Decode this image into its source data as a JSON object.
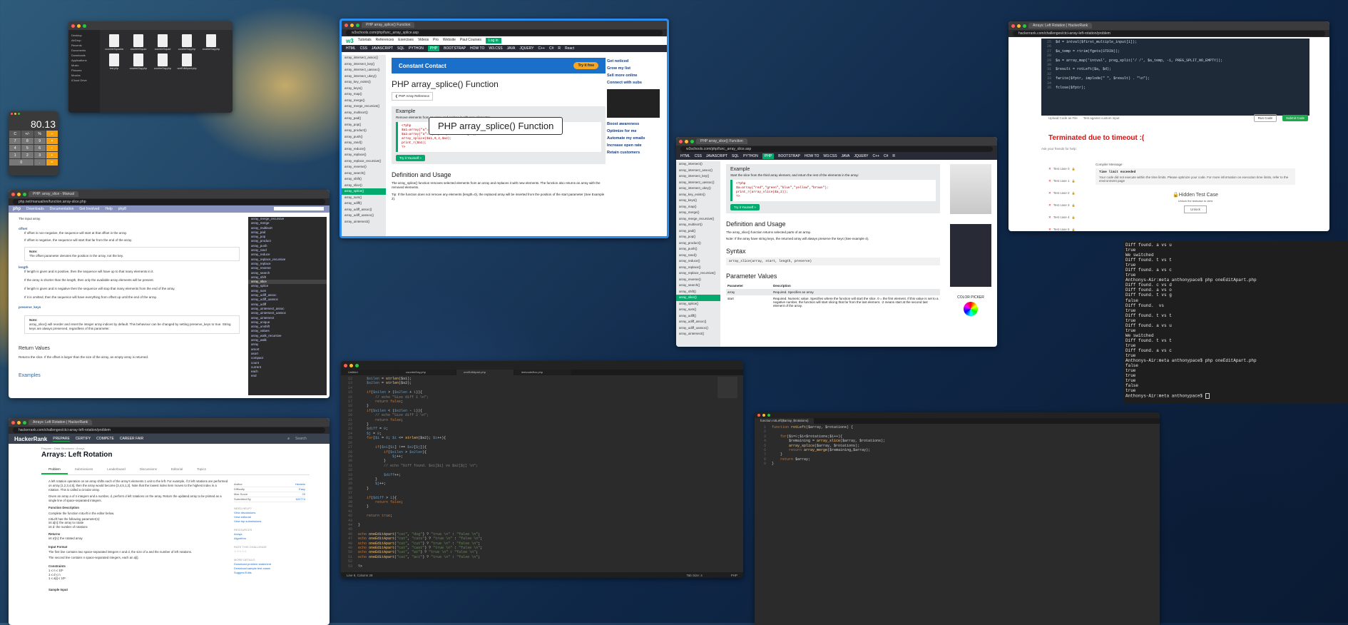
{
  "finder": {
    "sidebar": [
      "Desktop",
      "AirDrop",
      "Recents",
      "Documents",
      "Downloads",
      "Applications",
      "Music",
      "Pictures",
      "Movies",
      "iCloud Drive"
    ],
    "files": [
      "countrieSquadra",
      "countrieSquad",
      "countrieSquad",
      "counterDay.php",
      "counterDay.php",
      "test.php",
      "counterDay.php",
      "counterDay.php",
      "oneEditApart.php"
    ]
  },
  "calculator": {
    "display": "80.13",
    "keys": [
      "C",
      "+/-",
      "%",
      "÷",
      "7",
      "8",
      "9",
      "×",
      "4",
      "5",
      "6",
      "−",
      "1",
      "2",
      "3",
      "+",
      "0",
      ".",
      "="
    ]
  },
  "w3main": {
    "tabs": [
      "PHP array_splice() Function"
    ],
    "url": "w3schools.com/php/func_array_splice.asp",
    "nav": [
      "HTML",
      "CSS",
      "JAVASCRIPT",
      "SQL",
      "PYTHON",
      "PHP",
      "BOOTSTRAP",
      "HOW TO",
      "W3.CSS",
      "JAVA",
      "JQUERY",
      "C++",
      "C#",
      "R",
      "React"
    ],
    "top_links": [
      "Tutorials",
      "References",
      "Exercises",
      "Videos",
      "Pro",
      "Website",
      "Paul Courses",
      "Log in"
    ],
    "ad_text": "Constant Contact",
    "ad_button": "Try it free",
    "heading": "PHP array_splice() Function",
    "ref_button": "❮ PHP Array Reference",
    "example_label": "Example",
    "example_desc": "Remove elements from an array and replace it with new elements:",
    "code_lines": [
      "<?php",
      "$a1=array(\"a\"=>\"red\",\"b\"=>\"green\",\"c\"=>\"blue\",\"d\"=>\"yellow\");",
      "$a2=array(\"a\"=>\"purple\",\"b\"=>\"orange\");",
      "array_splice($a1,0,2,$a2);",
      "print_r($a1);",
      "?>"
    ],
    "try_button": "Try it Yourself »",
    "def_heading": "Definition and Usage",
    "def_text": "The array_splice() function removes selected elements from an array and replaces it with new elements. The function also returns an array with the removed elements.",
    "tip": "Tip: If the function does not remove any elements (length=0), the replaced array will be inserted from the position of the start parameter (See Example 2).",
    "sidebar": [
      "array_intersect_assoc()",
      "array_intersect_key()",
      "array_intersect_uassoc()",
      "array_intersect_ukey()",
      "array_key_exists()",
      "array_keys()",
      "array_map()",
      "array_merge()",
      "array_merge_recursive()",
      "array_multisort()",
      "array_pad()",
      "array_pop()",
      "array_product()",
      "array_push()",
      "array_rand()",
      "array_reduce()",
      "array_replace()",
      "array_replace_recursive()",
      "array_reverse()",
      "array_search()",
      "array_shift()",
      "array_slice()",
      "array_splice()",
      "array_sum()",
      "array_udiff()",
      "array_udiff_assoc()",
      "array_udiff_uassoc()",
      "array_uintersect()"
    ],
    "active_item": "array_splice()",
    "right_ads": [
      "Get noticed",
      "Grow my list",
      "Sell more online",
      "Connect with subs",
      "Boost awareness",
      "Optimize for me",
      "Automate my emails",
      "Increase open rate",
      "Retain customers"
    ],
    "tooltip": "PHP array_splice() Function"
  },
  "w3slice": {
    "tabs": [
      "PHP array_slice() Function"
    ],
    "url": "w3schools.com/php/func_array_slice.asp",
    "nav": [
      "HTML",
      "CSS",
      "JAVASCRIPT",
      "SQL",
      "PYTHON",
      "PHP",
      "BOOTSTRAP",
      "HOW TO",
      "W3.CSS",
      "JAVA",
      "JQUERY",
      "C++",
      "C#",
      "R"
    ],
    "example_label": "Example",
    "example_desc": "Start the slice from the third array element, and return the rest of the elements in the array:",
    "code_lines": [
      "<?php",
      "$a=array(\"red\",\"green\",\"blue\",\"yellow\",\"brown\");",
      "print_r(array_slice($a,2));",
      "?>"
    ],
    "try_button": "Try it Yourself »",
    "def_heading": "Definition and Usage",
    "def_text": "The array_slice() function returns selected parts of an array.",
    "note": "Note: If the array have string keys, the returned array will always preserve the keys (See example 4).",
    "syntax_heading": "Syntax",
    "syntax": "array_slice(array, start, length, preserve)",
    "param_heading": "Parameter Values",
    "param_cols": [
      "Parameter",
      "Description"
    ],
    "params": [
      {
        "name": "array",
        "desc": "Required. Specifies an array"
      },
      {
        "name": "start",
        "desc": "Required. Numeric value. Specifies where the function will start the slice. 0 = the first element. If this value is set to a negative number, the function will start slicing that far from the last element. -2 means start at the second last element of the array."
      }
    ],
    "sidebar": [
      "array_intersect()",
      "array_intersect_assoc()",
      "array_intersect_key()",
      "array_intersect_uassoc()",
      "array_intersect_ukey()",
      "array_key_exists()",
      "array_keys()",
      "array_map()",
      "array_merge()",
      "array_merge_recursive()",
      "array_multisort()",
      "array_pad()",
      "array_pop()",
      "array_product()",
      "array_push()",
      "array_rand()",
      "array_reduce()",
      "array_replace()",
      "array_replace_recursive()",
      "array_reverse()",
      "array_search()",
      "array_shift()",
      "array_slice()",
      "array_splice()",
      "array_sum()",
      "array_udiff()",
      "array_udiff_assoc()",
      "array_udiff_uassoc()",
      "array_uintersect()"
    ],
    "active_item": "array_slice()",
    "color_picker": "COLOR PICKER"
  },
  "phpnet": {
    "tabs": [
      "PHP: array_slice - Manual"
    ],
    "url": "php.net/manual/en/function.array-slice.php",
    "nav": [
      "php",
      "Downloads",
      "Documentation",
      "Get Involved",
      "Help",
      "php8"
    ],
    "search_placeholder": "Search",
    "input_label": "The input array.",
    "offset_heading": "offset",
    "offset_1": "If offset is non-negative, the sequence will start at that offset in the array.",
    "offset_2": "If offset is negative, the sequence will start that far from the end of the array.",
    "note_label": "Note:",
    "note_text": "The offset parameter denotes the position in the array, not the key.",
    "length_heading": "length",
    "length_1": "If length is given and is positive, then the sequence will have up to that many elements in it.",
    "length_2": "If the array is shorter than the length, then only the available array elements will be present.",
    "length_3": "If length is given and is negative then the sequence will stop that many elements from the end of the array.",
    "length_4": "If it is omitted, then the sequence will have everything from offset up until the end of the array.",
    "preserve_heading": "preserve_keys",
    "preserve_text": "array_slice() will reorder and reset the integer array indices by default. This behaviour can be changed by setting preserve_keys to true. String keys are always preserved, regardless of this parameter.",
    "return_heading": "Return Values",
    "return_text": "Returns the slice. If the offset is larger than the size of the array, an empty array is returned.",
    "examples_heading": "Examples",
    "sidebar": [
      "array_merge_recursive",
      "array_merge",
      "array_multisort",
      "array_pad",
      "array_pop",
      "array_product",
      "array_push",
      "array_rand",
      "array_reduce",
      "array_replace_recursive",
      "array_replace",
      "array_reverse",
      "array_search",
      "array_shift",
      "array_slice",
      "array_splice",
      "array_sum",
      "array_udiff_assoc",
      "array_udiff_uassoc",
      "array_udiff",
      "array_uintersect_assoc",
      "array_uintersect_uassoc",
      "array_uintersect",
      "array_unique",
      "array_unshift",
      "array_values",
      "array_walk_recursive",
      "array_walk",
      "array",
      "arsort",
      "asort",
      "compact",
      "count",
      "current",
      "each",
      "end"
    ]
  },
  "hr_top": {
    "tabs": [
      "Arrays: Left Rotation | HackerRank"
    ],
    "url": "hackerrank.com/challenges/ctci-array-left-rotation/problem",
    "code_lines": [
      {
        "n": "25",
        "t": "$d = intval($first_multiple_input[1]);"
      },
      {
        "n": "26",
        "t": ""
      },
      {
        "n": "27",
        "t": "$a_temp = rtrim(fgets(STDIN));"
      },
      {
        "n": "28",
        "t": ""
      },
      {
        "n": "29",
        "t": "$a = array_map('intval', preg_split('/ /', $a_temp, -1, PREG_SPLIT_NO_EMPTY));"
      },
      {
        "n": "30",
        "t": ""
      },
      {
        "n": "31",
        "t": "$result = rotLeft($a, $d);"
      },
      {
        "n": "32",
        "t": ""
      },
      {
        "n": "33",
        "t": "fwrite($fptr, implode(\" \", $result) . \"\\n\");"
      },
      {
        "n": "34",
        "t": ""
      },
      {
        "n": "35",
        "t": "fclose($fptr);"
      }
    ],
    "upload": "Upload Code as File",
    "custom_input": "Test against custom input",
    "run_button": "Run Code",
    "submit_button": "Submit Code",
    "timeout": "Terminated due to timeout :(",
    "share": "Ask your friends for help:",
    "test_cases": [
      "Test case 0",
      "Test case 1",
      "Test case 2",
      "Test case 3",
      "Test case 4",
      "Test case 5"
    ],
    "compiler_label": "Compiler Message",
    "compiler_title": "Time limit exceeded",
    "compiler_text": "Your code did not execute within the time limits. Please optimize your code. For more information on execution time limits, refer to the environment page",
    "hidden": "Hidden Test Case",
    "hidden_sub": "Unlock the testcase to view",
    "unlock": "Unlock"
  },
  "hr_bottom": {
    "tabs": [
      "Arrays: Left Rotation | HackerRank"
    ],
    "url": "hackerrank.com/challenges/ctci-array-left-rotation/problem",
    "logo": "HackerRank",
    "nav": [
      "PREPARE",
      "CERTIFY",
      "COMPETE",
      "CAREER FAIR"
    ],
    "search_placeholder": "Search",
    "crumb": "Prepare › Data Structures › Arrays",
    "title": "Arrays: Left Rotation",
    "tabs2": [
      "Problem",
      "Submissions",
      "Leaderboard",
      "Discussions",
      "Editorial",
      "Topics"
    ],
    "para1": "A left rotation operation on an array shifts each of the array's elements 1 unit to the left. For example, if 2 left rotations are performed on array [1,2,3,4,5], then the array would become [3,4,5,1,2]. Note that the lowest index item moves to the highest index in a rotation. This is called a circular array.",
    "para2": "Given an array a of n integers and a number, d, perform d left rotations on the array. Return the updated array to be printed as a single line of space-separated integers.",
    "func_desc": "Function Description",
    "func_1": "Complete the function rotLeft in the editor below.",
    "func_2": "rotLeft has the following parameter(s):",
    "func_3": "int a[n]: the array to rotate",
    "func_4": "int d: the number of rotations",
    "returns": "Returns",
    "returns_1": "int a'[n]: the rotated array",
    "input_format": "Input Format",
    "input_1": "The first line contains two space-separated integers n and d, the size of a and the number of left rotations.",
    "input_2": "The second line contains n space-separated integers, each an a[i].",
    "constraints": "Constraints",
    "c1": "1 ≤ n ≤ 10⁵",
    "c2": "1 ≤ d ≤ n",
    "c3": "1 ≤ a[i] ≤ 10⁶",
    "sample": "Sample Input",
    "meta": [
      {
        "k": "Author",
        "v": "Heraldo"
      },
      {
        "k": "Difficulty",
        "v": "Easy"
      },
      {
        "k": "Max Score",
        "v": "20"
      },
      {
        "k": "Submitted By",
        "v": "620774"
      }
    ],
    "need_help": "NEED HELP?",
    "help_links": [
      "View discussions",
      "View editorial",
      "View top submissions"
    ],
    "resources": "RESOURCES",
    "res_links": [
      "Arrays",
      "Algorithm"
    ],
    "rate": "RATE THIS CHALLENGE",
    "more": "MORE DETAILS",
    "more_links": [
      "Download problem statement",
      "Download sample test cases",
      "Suggest Edits"
    ]
  },
  "sublime": {
    "tabs": [
      "Untitled",
      "counterDay.php",
      "oneEditApart.php",
      "leetcode/fizz.php"
    ],
    "status_left": "Line 9, Column 28",
    "status_right": "Tab Size: 4",
    "status_lang": "PHP",
    "lines": [
      {
        "n": "12",
        "h": "    <span class='nm'>$s1len</span> = <span class='fn'>strlen</span>($s1);"
      },
      {
        "n": "13",
        "h": "    <span class='nm'>$s2len</span> = <span class='fn'>strlen</span>($s2);"
      },
      {
        "n": "14",
        "h": ""
      },
      {
        "n": "15",
        "h": "    <span class='kw'>if</span>(<span class='nm'>$s1len</span> > (<span class='nm'>$s2len</span> + <span class='nm'>1</span>)){"
      },
      {
        "n": "16",
        "h": "        <span class='cm'>// echo \"Size diff 1 \\n\";</span>"
      },
      {
        "n": "17",
        "h": "        <span class='kw'>return</span> <span class='kw'>false</span>;"
      },
      {
        "n": "18",
        "h": "    }"
      },
      {
        "n": "19",
        "h": "    <span class='kw'>if</span>(<span class='nm'>$s1len</span> < (<span class='nm'>$s2len</span> - <span class='nm'>1</span>)){"
      },
      {
        "n": "20",
        "h": "        <span class='cm'>// echo \"Size diff 2 \\n\";</span>"
      },
      {
        "n": "21",
        "h": "        <span class='kw'>return</span> <span class='kw'>false</span>;"
      },
      {
        "n": "22",
        "h": "    }"
      },
      {
        "n": "23",
        "h": "    <span class='nm'>$diff</span> = <span class='nm'>0</span>;"
      },
      {
        "n": "24",
        "h": "    <span class='nm'>$j</span> = <span class='nm'>0</span>;"
      },
      {
        "n": "25",
        "h": "    <span class='kw'>for</span>(<span class='nm'>$i</span> = <span class='nm'>0</span>; <span class='nm'>$i</span> <= <span class='fn'>strlen</span>($s2); <span class='nm'>$i</span>++){"
      },
      {
        "n": "26",
        "h": ""
      },
      {
        "n": "27",
        "h": "        <span class='kw'>if</span>(<span class='nm'>$s1</span>[<span class='nm'>$i</span>] !== <span class='nm'>$s2</span>[<span class='nm'>$j</span>]){"
      },
      {
        "n": "28",
        "h": "            <span class='kw'>if</span>(<span class='nm'>$s1len</span> > <span class='nm'>$s2len</span>){"
      },
      {
        "n": "29",
        "h": "                <span class='nm'>$j</span>++;"
      },
      {
        "n": "30",
        "h": "            }"
      },
      {
        "n": "31",
        "h": "            <span class='cm'>// echo \"Diff found. $s1[$i] vs $s2[$j] \\n\";</span>"
      },
      {
        "n": "32",
        "h": ""
      },
      {
        "n": "33",
        "h": "            <span class='nm'>$diff</span>++;"
      },
      {
        "n": "34",
        "h": "        }"
      },
      {
        "n": "35",
        "h": "        <span class='nm'>$j</span>++;"
      },
      {
        "n": "36",
        "h": "    }"
      },
      {
        "n": "37",
        "h": ""
      },
      {
        "n": "38",
        "h": "    <span class='kw'>if</span>(<span class='nm'>$diff</span> > <span class='nm'>1</span>){"
      },
      {
        "n": "39",
        "h": "        <span class='kw'>return</span> <span class='kw'>false</span>;"
      },
      {
        "n": "40",
        "h": "    }"
      },
      {
        "n": "41",
        "h": ""
      },
      {
        "n": "42",
        "h": "    <span class='kw'>return</span> <span class='kw'>true</span>;"
      },
      {
        "n": "43",
        "h": ""
      },
      {
        "n": "44",
        "h": "}"
      },
      {
        "n": "45",
        "h": ""
      },
      {
        "n": "46",
        "h": "<span class='kw'>echo</span> <span class='fn'>oneEditApart</span>(<span class='st'>\"cat\"</span>, <span class='st'>\"dog\"</span>) ? <span class='st'>\"true \\n\"</span> : <span class='st'>\"false \\n\"</span>;"
      },
      {
        "n": "47",
        "h": "<span class='kw'>echo</span> <span class='fn'>oneEditApart</span>(<span class='st'>\"cat\"</span>, <span class='st'>\"cats\"</span>) ? <span class='st'>\"true \\n\"</span> : <span class='st'>\"false \\n\"</span>;"
      },
      {
        "n": "48",
        "h": "<span class='kw'>echo</span> <span class='fn'>oneEditApart</span>(<span class='st'>\"cat\"</span>, <span class='st'>\"cut\"</span>) ? <span class='st'>\"true \\n\"</span> : <span class='st'>\"false \\n\"</span>;"
      },
      {
        "n": "49",
        "h": "<span class='kw'>echo</span> <span class='fn'>oneEditApart</span>(<span class='st'>\"cat\"</span>, <span class='st'>\"cast\"</span>) ? <span class='st'>\"true \\n\"</span> : <span class='st'>\"false \\n\"</span>;"
      },
      {
        "n": "50",
        "h": "<span class='kw'>echo</span> <span class='fn'>oneEditApart</span>(<span class='st'>\"cat\"</span>, <span class='st'>\"at\"</span>) ? <span class='st'>\"true \\n\"</span> : <span class='st'>\"false \\n\"</span>;"
      },
      {
        "n": "51",
        "h": "<span class='kw'>echo</span> <span class='fn'>oneEditApart</span>(<span class='st'>\"cat\"</span>, <span class='st'>\"act\"</span>) ? <span class='st'>\"true \\n\"</span> : <span class='st'>\"false \\n\"</span>;"
      },
      {
        "n": "52",
        "h": ""
      },
      {
        "n": "53",
        "h": "?>"
      }
    ]
  },
  "terminal": {
    "lines": [
      "Diff found. a vs u",
      "true",
      "We switched",
      "Diff found. t vs t",
      "true",
      "Diff found. a vs c",
      "true",
      "Anthonys-Air:meta anthonypace$ php oneEditApart.php",
      "Diff found. c vs d",
      "Diff found. a vs o",
      "Diff found. t vs g",
      "false",
      "Diff found.  vs",
      "true",
      "Diff found. t vs t",
      "true",
      "Diff found. a vs u",
      "true",
      "We switched",
      "Diff found. t vs t",
      "true",
      "Diff found. a vs c",
      "true",
      "Anthonys-Air:meta anthonypace$ php oneEditApart.php",
      "false",
      "true",
      "true",
      "true",
      "false",
      "true",
      "Anthonys-Air:meta anthonypace$ "
    ]
  },
  "editor2": {
    "tab": "function rotLeft($array, $rotations)",
    "lines": [
      {
        "n": "1",
        "h": "<span class='kw'>function</span> <span class='fn'>rotLeft</span>($array, $rotations) {"
      },
      {
        "n": "2",
        "h": ""
      },
      {
        "n": "3",
        "h": "    <span class='kw'>for</span>($i=<span class='nm'>0</span>;$i<$rotations;$i++){"
      },
      {
        "n": "4",
        "h": "        $remaining = <span class='fn'>array_slice</span>($array, $rotations);"
      },
      {
        "n": "5",
        "h": "        <span class='fn'>array_splice</span>($array, $rotations);"
      },
      {
        "n": "6",
        "h": "        <span class='kw'>return</span> <span class='fn'>array_merge</span>($remaining,$array);"
      },
      {
        "n": "7",
        "h": "    }"
      },
      {
        "n": "8",
        "h": "    <span class='kw'>return</span> $array;"
      },
      {
        "n": "9",
        "h": "}"
      }
    ]
  }
}
